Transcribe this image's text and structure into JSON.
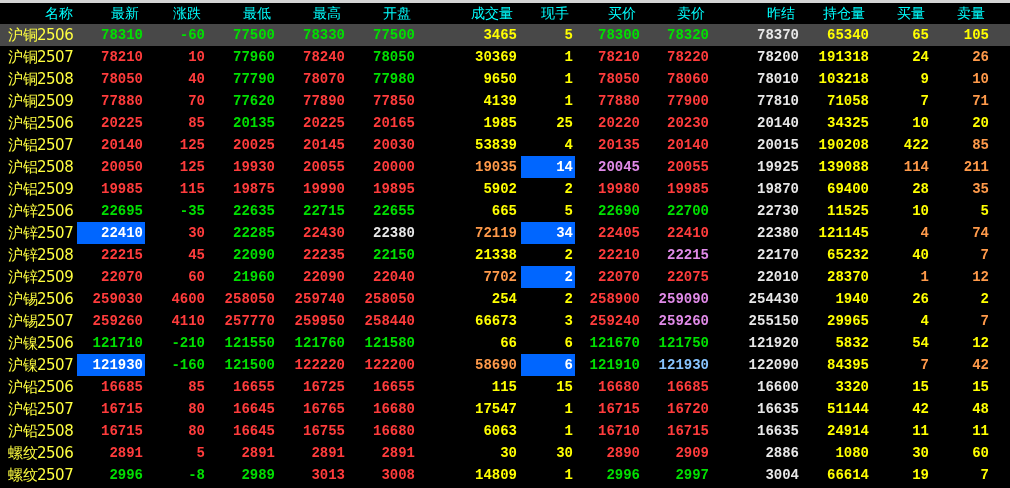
{
  "columns": [
    "名称",
    "最新",
    "涨跌",
    "最低",
    "最高",
    "开盘",
    "成交量",
    "现手",
    "买价",
    "卖价",
    "昨结",
    "持仓量",
    "买量",
    "卖量"
  ],
  "rows": [
    {
      "name": "沪铜2506",
      "selected": true,
      "cells": [
        {
          "text": "78310",
          "color": "#00e000",
          "highlighted": false
        },
        {
          "text": "-60",
          "color": "#00e000",
          "highlighted": false
        },
        {
          "text": "77500",
          "color": "#00e000",
          "highlighted": false
        },
        {
          "text": "78330",
          "color": "#00e000",
          "highlighted": false
        },
        {
          "text": "77500",
          "color": "#00e000",
          "highlighted": false
        },
        {
          "text": "3465",
          "color": "#ffff00",
          "highlighted": false
        },
        {
          "text": "5",
          "color": "#ffff00",
          "highlighted": false
        },
        {
          "text": "78300",
          "color": "#00e000",
          "highlighted": false
        },
        {
          "text": "78320",
          "color": "#00e000",
          "highlighted": false
        },
        {
          "text": "78370",
          "color": "#e8e8e8",
          "highlighted": false
        },
        {
          "text": "65340",
          "color": "#ffff00",
          "highlighted": false
        },
        {
          "text": "65",
          "color": "#ffff00",
          "highlighted": false
        },
        {
          "text": "105",
          "color": "#ffff00",
          "highlighted": false
        }
      ]
    },
    {
      "name": "沪铜2507",
      "selected": false,
      "cells": [
        {
          "text": "78210",
          "color": "#ff3c3c",
          "highlighted": false
        },
        {
          "text": "10",
          "color": "#ff3c3c",
          "highlighted": false
        },
        {
          "text": "77960",
          "color": "#00e000",
          "highlighted": false
        },
        {
          "text": "78240",
          "color": "#ff3c3c",
          "highlighted": false
        },
        {
          "text": "78050",
          "color": "#00e000",
          "highlighted": false
        },
        {
          "text": "30369",
          "color": "#ffff00",
          "highlighted": false
        },
        {
          "text": "1",
          "color": "#ffff00",
          "highlighted": false
        },
        {
          "text": "78210",
          "color": "#ff3c3c",
          "highlighted": false
        },
        {
          "text": "78220",
          "color": "#ff3c3c",
          "highlighted": false
        },
        {
          "text": "78200",
          "color": "#e8e8e8",
          "highlighted": false
        },
        {
          "text": "191318",
          "color": "#ffff00",
          "highlighted": false
        },
        {
          "text": "24",
          "color": "#ffff00",
          "highlighted": false
        },
        {
          "text": "26",
          "color": "#ff9a4a",
          "highlighted": false
        }
      ]
    },
    {
      "name": "沪铜2508",
      "selected": false,
      "cells": [
        {
          "text": "78050",
          "color": "#ff3c3c",
          "highlighted": false
        },
        {
          "text": "40",
          "color": "#ff3c3c",
          "highlighted": false
        },
        {
          "text": "77790",
          "color": "#00e000",
          "highlighted": false
        },
        {
          "text": "78070",
          "color": "#ff3c3c",
          "highlighted": false
        },
        {
          "text": "77980",
          "color": "#00e000",
          "highlighted": false
        },
        {
          "text": "9650",
          "color": "#ffff00",
          "highlighted": false
        },
        {
          "text": "1",
          "color": "#ffff00",
          "highlighted": false
        },
        {
          "text": "78050",
          "color": "#ff3c3c",
          "highlighted": false
        },
        {
          "text": "78060",
          "color": "#ff3c3c",
          "highlighted": false
        },
        {
          "text": "78010",
          "color": "#e8e8e8",
          "highlighted": false
        },
        {
          "text": "103218",
          "color": "#ffff00",
          "highlighted": false
        },
        {
          "text": "9",
          "color": "#ffff00",
          "highlighted": false
        },
        {
          "text": "10",
          "color": "#ff9a4a",
          "highlighted": false
        }
      ]
    },
    {
      "name": "沪铜2509",
      "selected": false,
      "cells": [
        {
          "text": "77880",
          "color": "#ff3c3c",
          "highlighted": false
        },
        {
          "text": "70",
          "color": "#ff3c3c",
          "highlighted": false
        },
        {
          "text": "77620",
          "color": "#00e000",
          "highlighted": false
        },
        {
          "text": "77890",
          "color": "#ff3c3c",
          "highlighted": false
        },
        {
          "text": "77850",
          "color": "#ff3c3c",
          "highlighted": false
        },
        {
          "text": "4139",
          "color": "#ffff00",
          "highlighted": false
        },
        {
          "text": "1",
          "color": "#ffff00",
          "highlighted": false
        },
        {
          "text": "77880",
          "color": "#ff3c3c",
          "highlighted": false
        },
        {
          "text": "77900",
          "color": "#ff3c3c",
          "highlighted": false
        },
        {
          "text": "77810",
          "color": "#e8e8e8",
          "highlighted": false
        },
        {
          "text": "71058",
          "color": "#ffff00",
          "highlighted": false
        },
        {
          "text": "7",
          "color": "#ffff00",
          "highlighted": false
        },
        {
          "text": "71",
          "color": "#ff9a4a",
          "highlighted": false
        }
      ]
    },
    {
      "name": "沪铝2506",
      "selected": false,
      "cells": [
        {
          "text": "20225",
          "color": "#ff3c3c",
          "highlighted": false
        },
        {
          "text": "85",
          "color": "#ff3c3c",
          "highlighted": false
        },
        {
          "text": "20135",
          "color": "#00e000",
          "highlighted": false
        },
        {
          "text": "20225",
          "color": "#ff3c3c",
          "highlighted": false
        },
        {
          "text": "20165",
          "color": "#ff3c3c",
          "highlighted": false
        },
        {
          "text": "1985",
          "color": "#ffff00",
          "highlighted": false
        },
        {
          "text": "25",
          "color": "#ffff00",
          "highlighted": false
        },
        {
          "text": "20220",
          "color": "#ff3c3c",
          "highlighted": false
        },
        {
          "text": "20230",
          "color": "#ff3c3c",
          "highlighted": false
        },
        {
          "text": "20140",
          "color": "#e8e8e8",
          "highlighted": false
        },
        {
          "text": "34325",
          "color": "#ffff00",
          "highlighted": false
        },
        {
          "text": "10",
          "color": "#ffff00",
          "highlighted": false
        },
        {
          "text": "20",
          "color": "#ffff00",
          "highlighted": false
        }
      ]
    },
    {
      "name": "沪铝2507",
      "selected": false,
      "cells": [
        {
          "text": "20140",
          "color": "#ff3c3c",
          "highlighted": false
        },
        {
          "text": "125",
          "color": "#ff3c3c",
          "highlighted": false
        },
        {
          "text": "20025",
          "color": "#ff3c3c",
          "highlighted": false
        },
        {
          "text": "20145",
          "color": "#ff3c3c",
          "highlighted": false
        },
        {
          "text": "20030",
          "color": "#ff3c3c",
          "highlighted": false
        },
        {
          "text": "53839",
          "color": "#ffff00",
          "highlighted": false
        },
        {
          "text": "4",
          "color": "#ffff00",
          "highlighted": false
        },
        {
          "text": "20135",
          "color": "#ff3c3c",
          "highlighted": false
        },
        {
          "text": "20140",
          "color": "#ff3c3c",
          "highlighted": false
        },
        {
          "text": "20015",
          "color": "#e8e8e8",
          "highlighted": false
        },
        {
          "text": "190208",
          "color": "#ffff00",
          "highlighted": false
        },
        {
          "text": "422",
          "color": "#ffff00",
          "highlighted": false
        },
        {
          "text": "85",
          "color": "#ff9a4a",
          "highlighted": false
        }
      ]
    },
    {
      "name": "沪铝2508",
      "selected": false,
      "cells": [
        {
          "text": "20050",
          "color": "#ff3c3c",
          "highlighted": false
        },
        {
          "text": "125",
          "color": "#ff3c3c",
          "highlighted": false
        },
        {
          "text": "19930",
          "color": "#ff3c3c",
          "highlighted": false
        },
        {
          "text": "20055",
          "color": "#ff3c3c",
          "highlighted": false
        },
        {
          "text": "20000",
          "color": "#ff3c3c",
          "highlighted": false
        },
        {
          "text": "19035",
          "color": "#ff9a4a",
          "highlighted": false
        },
        {
          "text": "14",
          "color": "#ffffff",
          "highlighted": true
        },
        {
          "text": "20045",
          "color": "#e08ae8",
          "highlighted": false
        },
        {
          "text": "20055",
          "color": "#ff3c3c",
          "highlighted": false
        },
        {
          "text": "19925",
          "color": "#e8e8e8",
          "highlighted": false
        },
        {
          "text": "139088",
          "color": "#ffff00",
          "highlighted": false
        },
        {
          "text": "114",
          "color": "#ff9a4a",
          "highlighted": false
        },
        {
          "text": "211",
          "color": "#ff9a4a",
          "highlighted": false
        }
      ]
    },
    {
      "name": "沪铝2509",
      "selected": false,
      "cells": [
        {
          "text": "19985",
          "color": "#ff3c3c",
          "highlighted": false
        },
        {
          "text": "115",
          "color": "#ff3c3c",
          "highlighted": false
        },
        {
          "text": "19875",
          "color": "#ff3c3c",
          "highlighted": false
        },
        {
          "text": "19990",
          "color": "#ff3c3c",
          "highlighted": false
        },
        {
          "text": "19895",
          "color": "#ff3c3c",
          "highlighted": false
        },
        {
          "text": "5902",
          "color": "#ffff00",
          "highlighted": false
        },
        {
          "text": "2",
          "color": "#ffff00",
          "highlighted": false
        },
        {
          "text": "19980",
          "color": "#ff3c3c",
          "highlighted": false
        },
        {
          "text": "19985",
          "color": "#ff3c3c",
          "highlighted": false
        },
        {
          "text": "19870",
          "color": "#e8e8e8",
          "highlighted": false
        },
        {
          "text": "69400",
          "color": "#ffff00",
          "highlighted": false
        },
        {
          "text": "28",
          "color": "#ffff00",
          "highlighted": false
        },
        {
          "text": "35",
          "color": "#ff9a4a",
          "highlighted": false
        }
      ]
    },
    {
      "name": "沪锌2506",
      "selected": false,
      "cells": [
        {
          "text": "22695",
          "color": "#00e000",
          "highlighted": false
        },
        {
          "text": "-35",
          "color": "#00e000",
          "highlighted": false
        },
        {
          "text": "22635",
          "color": "#00e000",
          "highlighted": false
        },
        {
          "text": "22715",
          "color": "#00e000",
          "highlighted": false
        },
        {
          "text": "22655",
          "color": "#00e000",
          "highlighted": false
        },
        {
          "text": "665",
          "color": "#ffff00",
          "highlighted": false
        },
        {
          "text": "5",
          "color": "#ffff00",
          "highlighted": false
        },
        {
          "text": "22690",
          "color": "#00e000",
          "highlighted": false
        },
        {
          "text": "22700",
          "color": "#00e000",
          "highlighted": false
        },
        {
          "text": "22730",
          "color": "#e8e8e8",
          "highlighted": false
        },
        {
          "text": "11525",
          "color": "#ffff00",
          "highlighted": false
        },
        {
          "text": "10",
          "color": "#ffff00",
          "highlighted": false
        },
        {
          "text": "5",
          "color": "#ffff00",
          "highlighted": false
        }
      ]
    },
    {
      "name": "沪锌2507",
      "selected": false,
      "cells": [
        {
          "text": "22410",
          "color": "#ffffff",
          "highlighted": true
        },
        {
          "text": "30",
          "color": "#ff3c3c",
          "highlighted": false
        },
        {
          "text": "22285",
          "color": "#00e000",
          "highlighted": false
        },
        {
          "text": "22430",
          "color": "#ff3c3c",
          "highlighted": false
        },
        {
          "text": "22380",
          "color": "#e8e8e8",
          "highlighted": false
        },
        {
          "text": "72119",
          "color": "#ff9a4a",
          "highlighted": false
        },
        {
          "text": "34",
          "color": "#ffffff",
          "highlighted": true
        },
        {
          "text": "22405",
          "color": "#ff3c3c",
          "highlighted": false
        },
        {
          "text": "22410",
          "color": "#ff3c3c",
          "highlighted": false
        },
        {
          "text": "22380",
          "color": "#e8e8e8",
          "highlighted": false
        },
        {
          "text": "121145",
          "color": "#ffff00",
          "highlighted": false
        },
        {
          "text": "4",
          "color": "#ff9a4a",
          "highlighted": false
        },
        {
          "text": "74",
          "color": "#ff9a4a",
          "highlighted": false
        }
      ]
    },
    {
      "name": "沪锌2508",
      "selected": false,
      "cells": [
        {
          "text": "22215",
          "color": "#ff3c3c",
          "highlighted": false
        },
        {
          "text": "45",
          "color": "#ff3c3c",
          "highlighted": false
        },
        {
          "text": "22090",
          "color": "#00e000",
          "highlighted": false
        },
        {
          "text": "22235",
          "color": "#ff3c3c",
          "highlighted": false
        },
        {
          "text": "22150",
          "color": "#00e000",
          "highlighted": false
        },
        {
          "text": "21338",
          "color": "#ffff00",
          "highlighted": false
        },
        {
          "text": "2",
          "color": "#ffff00",
          "highlighted": false
        },
        {
          "text": "22210",
          "color": "#ff3c3c",
          "highlighted": false
        },
        {
          "text": "22215",
          "color": "#e08ae8",
          "highlighted": false
        },
        {
          "text": "22170",
          "color": "#e8e8e8",
          "highlighted": false
        },
        {
          "text": "65232",
          "color": "#ffff00",
          "highlighted": false
        },
        {
          "text": "40",
          "color": "#ffff00",
          "highlighted": false
        },
        {
          "text": "7",
          "color": "#ff9a4a",
          "highlighted": false
        }
      ]
    },
    {
      "name": "沪锌2509",
      "selected": false,
      "cells": [
        {
          "text": "22070",
          "color": "#ff3c3c",
          "highlighted": false
        },
        {
          "text": "60",
          "color": "#ff3c3c",
          "highlighted": false
        },
        {
          "text": "21960",
          "color": "#00e000",
          "highlighted": false
        },
        {
          "text": "22090",
          "color": "#ff3c3c",
          "highlighted": false
        },
        {
          "text": "22040",
          "color": "#ff3c3c",
          "highlighted": false
        },
        {
          "text": "7702",
          "color": "#ff9a4a",
          "highlighted": false
        },
        {
          "text": "2",
          "color": "#ffffff",
          "highlighted": true
        },
        {
          "text": "22070",
          "color": "#ff3c3c",
          "highlighted": false
        },
        {
          "text": "22075",
          "color": "#ff3c3c",
          "highlighted": false
        },
        {
          "text": "22010",
          "color": "#e8e8e8",
          "highlighted": false
        },
        {
          "text": "28370",
          "color": "#ffff00",
          "highlighted": false
        },
        {
          "text": "1",
          "color": "#ff9a4a",
          "highlighted": false
        },
        {
          "text": "12",
          "color": "#ff9a4a",
          "highlighted": false
        }
      ]
    },
    {
      "name": "沪锡2506",
      "selected": false,
      "cells": [
        {
          "text": "259030",
          "color": "#ff3c3c",
          "highlighted": false
        },
        {
          "text": "4600",
          "color": "#ff3c3c",
          "highlighted": false
        },
        {
          "text": "258050",
          "color": "#ff3c3c",
          "highlighted": false
        },
        {
          "text": "259740",
          "color": "#ff3c3c",
          "highlighted": false
        },
        {
          "text": "258050",
          "color": "#ff3c3c",
          "highlighted": false
        },
        {
          "text": "254",
          "color": "#ffff00",
          "highlighted": false
        },
        {
          "text": "2",
          "color": "#ffff00",
          "highlighted": false
        },
        {
          "text": "258900",
          "color": "#ff3c3c",
          "highlighted": false
        },
        {
          "text": "259090",
          "color": "#e08ae8",
          "highlighted": false
        },
        {
          "text": "254430",
          "color": "#e8e8e8",
          "highlighted": false
        },
        {
          "text": "1940",
          "color": "#ffff00",
          "highlighted": false
        },
        {
          "text": "26",
          "color": "#ffff00",
          "highlighted": false
        },
        {
          "text": "2",
          "color": "#ffff00",
          "highlighted": false
        }
      ]
    },
    {
      "name": "沪锡2507",
      "selected": false,
      "cells": [
        {
          "text": "259260",
          "color": "#ff3c3c",
          "highlighted": false
        },
        {
          "text": "4110",
          "color": "#ff3c3c",
          "highlighted": false
        },
        {
          "text": "257770",
          "color": "#ff3c3c",
          "highlighted": false
        },
        {
          "text": "259950",
          "color": "#ff3c3c",
          "highlighted": false
        },
        {
          "text": "258440",
          "color": "#ff3c3c",
          "highlighted": false
        },
        {
          "text": "66673",
          "color": "#ffff00",
          "highlighted": false
        },
        {
          "text": "3",
          "color": "#ffff00",
          "highlighted": false
        },
        {
          "text": "259240",
          "color": "#ff3c3c",
          "highlighted": false
        },
        {
          "text": "259260",
          "color": "#e08ae8",
          "highlighted": false
        },
        {
          "text": "255150",
          "color": "#e8e8e8",
          "highlighted": false
        },
        {
          "text": "29965",
          "color": "#ffff00",
          "highlighted": false
        },
        {
          "text": "4",
          "color": "#ffff00",
          "highlighted": false
        },
        {
          "text": "7",
          "color": "#ff9a4a",
          "highlighted": false
        }
      ]
    },
    {
      "name": "沪镍2506",
      "selected": false,
      "cells": [
        {
          "text": "121710",
          "color": "#00e000",
          "highlighted": false
        },
        {
          "text": "-210",
          "color": "#00e000",
          "highlighted": false
        },
        {
          "text": "121550",
          "color": "#00e000",
          "highlighted": false
        },
        {
          "text": "121760",
          "color": "#00e000",
          "highlighted": false
        },
        {
          "text": "121580",
          "color": "#00e000",
          "highlighted": false
        },
        {
          "text": "66",
          "color": "#ffff00",
          "highlighted": false
        },
        {
          "text": "6",
          "color": "#ffff00",
          "highlighted": false
        },
        {
          "text": "121670",
          "color": "#00e000",
          "highlighted": false
        },
        {
          "text": "121750",
          "color": "#00e000",
          "highlighted": false
        },
        {
          "text": "121920",
          "color": "#e8e8e8",
          "highlighted": false
        },
        {
          "text": "5832",
          "color": "#ffff00",
          "highlighted": false
        },
        {
          "text": "54",
          "color": "#ffff00",
          "highlighted": false
        },
        {
          "text": "12",
          "color": "#ffff00",
          "highlighted": false
        }
      ]
    },
    {
      "name": "沪镍2507",
      "selected": false,
      "cells": [
        {
          "text": "121930",
          "color": "#ffffff",
          "highlighted": true
        },
        {
          "text": "-160",
          "color": "#00e000",
          "highlighted": false
        },
        {
          "text": "121500",
          "color": "#00e000",
          "highlighted": false
        },
        {
          "text": "122220",
          "color": "#ff3c3c",
          "highlighted": false
        },
        {
          "text": "122200",
          "color": "#ff3c3c",
          "highlighted": false
        },
        {
          "text": "58690",
          "color": "#ff9a4a",
          "highlighted": false
        },
        {
          "text": "6",
          "color": "#ffffff",
          "highlighted": true
        },
        {
          "text": "121910",
          "color": "#00e000",
          "highlighted": false
        },
        {
          "text": "121930",
          "color": "#88c4ff",
          "highlighted": false
        },
        {
          "text": "122090",
          "color": "#e8e8e8",
          "highlighted": false
        },
        {
          "text": "84395",
          "color": "#ffff00",
          "highlighted": false
        },
        {
          "text": "7",
          "color": "#ff9a4a",
          "highlighted": false
        },
        {
          "text": "42",
          "color": "#ff9a4a",
          "highlighted": false
        }
      ]
    },
    {
      "name": "沪铅2506",
      "selected": false,
      "cells": [
        {
          "text": "16685",
          "color": "#ff3c3c",
          "highlighted": false
        },
        {
          "text": "85",
          "color": "#ff3c3c",
          "highlighted": false
        },
        {
          "text": "16655",
          "color": "#ff3c3c",
          "highlighted": false
        },
        {
          "text": "16725",
          "color": "#ff3c3c",
          "highlighted": false
        },
        {
          "text": "16655",
          "color": "#ff3c3c",
          "highlighted": false
        },
        {
          "text": "115",
          "color": "#ffff00",
          "highlighted": false
        },
        {
          "text": "15",
          "color": "#ffff00",
          "highlighted": false
        },
        {
          "text": "16680",
          "color": "#ff3c3c",
          "highlighted": false
        },
        {
          "text": "16685",
          "color": "#ff3c3c",
          "highlighted": false
        },
        {
          "text": "16600",
          "color": "#e8e8e8",
          "highlighted": false
        },
        {
          "text": "3320",
          "color": "#ffff00",
          "highlighted": false
        },
        {
          "text": "15",
          "color": "#ffff00",
          "highlighted": false
        },
        {
          "text": "15",
          "color": "#ffff00",
          "highlighted": false
        }
      ]
    },
    {
      "name": "沪铅2507",
      "selected": false,
      "cells": [
        {
          "text": "16715",
          "color": "#ff3c3c",
          "highlighted": false
        },
        {
          "text": "80",
          "color": "#ff3c3c",
          "highlighted": false
        },
        {
          "text": "16645",
          "color": "#ff3c3c",
          "highlighted": false
        },
        {
          "text": "16765",
          "color": "#ff3c3c",
          "highlighted": false
        },
        {
          "text": "16680",
          "color": "#ff3c3c",
          "highlighted": false
        },
        {
          "text": "17547",
          "color": "#ffff00",
          "highlighted": false
        },
        {
          "text": "1",
          "color": "#ffff00",
          "highlighted": false
        },
        {
          "text": "16715",
          "color": "#ff3c3c",
          "highlighted": false
        },
        {
          "text": "16720",
          "color": "#ff3c3c",
          "highlighted": false
        },
        {
          "text": "16635",
          "color": "#e8e8e8",
          "highlighted": false
        },
        {
          "text": "51144",
          "color": "#ffff00",
          "highlighted": false
        },
        {
          "text": "42",
          "color": "#ffff00",
          "highlighted": false
        },
        {
          "text": "48",
          "color": "#ffff00",
          "highlighted": false
        }
      ]
    },
    {
      "name": "沪铅2508",
      "selected": false,
      "cells": [
        {
          "text": "16715",
          "color": "#ff3c3c",
          "highlighted": false
        },
        {
          "text": "80",
          "color": "#ff3c3c",
          "highlighted": false
        },
        {
          "text": "16645",
          "color": "#ff3c3c",
          "highlighted": false
        },
        {
          "text": "16755",
          "color": "#ff3c3c",
          "highlighted": false
        },
        {
          "text": "16680",
          "color": "#ff3c3c",
          "highlighted": false
        },
        {
          "text": "6063",
          "color": "#ffff00",
          "highlighted": false
        },
        {
          "text": "1",
          "color": "#ffff00",
          "highlighted": false
        },
        {
          "text": "16710",
          "color": "#ff3c3c",
          "highlighted": false
        },
        {
          "text": "16715",
          "color": "#ff3c3c",
          "highlighted": false
        },
        {
          "text": "16635",
          "color": "#e8e8e8",
          "highlighted": false
        },
        {
          "text": "24914",
          "color": "#ffff00",
          "highlighted": false
        },
        {
          "text": "11",
          "color": "#ffff00",
          "highlighted": false
        },
        {
          "text": "11",
          "color": "#ffff00",
          "highlighted": false
        }
      ]
    },
    {
      "name": "螺纹2506",
      "selected": false,
      "cells": [
        {
          "text": "2891",
          "color": "#ff3c3c",
          "highlighted": false
        },
        {
          "text": "5",
          "color": "#ff3c3c",
          "highlighted": false
        },
        {
          "text": "2891",
          "color": "#ff3c3c",
          "highlighted": false
        },
        {
          "text": "2891",
          "color": "#ff3c3c",
          "highlighted": false
        },
        {
          "text": "2891",
          "color": "#ff3c3c",
          "highlighted": false
        },
        {
          "text": "30",
          "color": "#ffff00",
          "highlighted": false
        },
        {
          "text": "30",
          "color": "#ffff00",
          "highlighted": false
        },
        {
          "text": "2890",
          "color": "#ff3c3c",
          "highlighted": false
        },
        {
          "text": "2909",
          "color": "#ff3c3c",
          "highlighted": false
        },
        {
          "text": "2886",
          "color": "#e8e8e8",
          "highlighted": false
        },
        {
          "text": "1080",
          "color": "#ffff00",
          "highlighted": false
        },
        {
          "text": "30",
          "color": "#ffff00",
          "highlighted": false
        },
        {
          "text": "60",
          "color": "#ffff00",
          "highlighted": false
        }
      ]
    },
    {
      "name": "螺纹2507",
      "selected": false,
      "cells": [
        {
          "text": "2996",
          "color": "#00e000",
          "highlighted": false
        },
        {
          "text": "-8",
          "color": "#00e000",
          "highlighted": false
        },
        {
          "text": "2989",
          "color": "#00e000",
          "highlighted": false
        },
        {
          "text": "3013",
          "color": "#ff3c3c",
          "highlighted": false
        },
        {
          "text": "3008",
          "color": "#ff3c3c",
          "highlighted": false
        },
        {
          "text": "14809",
          "color": "#ffff00",
          "highlighted": false
        },
        {
          "text": "1",
          "color": "#ffff00",
          "highlighted": false
        },
        {
          "text": "2996",
          "color": "#00e000",
          "highlighted": false
        },
        {
          "text": "2997",
          "color": "#00e000",
          "highlighted": false
        },
        {
          "text": "3004",
          "color": "#e8e8e8",
          "highlighted": false
        },
        {
          "text": "66614",
          "color": "#ffff00",
          "highlighted": false
        },
        {
          "text": "19",
          "color": "#ffff00",
          "highlighted": false
        },
        {
          "text": "7",
          "color": "#ffff00",
          "highlighted": false
        }
      ]
    }
  ]
}
